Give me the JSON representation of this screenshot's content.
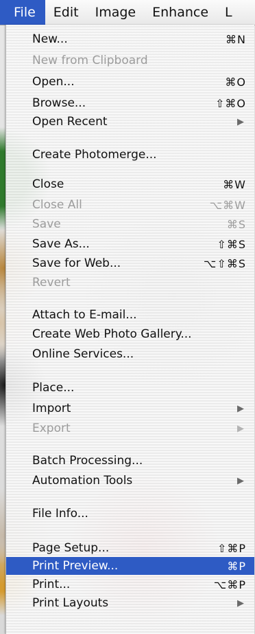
{
  "menubar": {
    "items": [
      "File",
      "Edit",
      "Image",
      "Enhance",
      "L"
    ]
  },
  "menu": {
    "items": [
      {
        "label": "New...",
        "shortcut": "⌘N"
      },
      {
        "label": "New from Clipboard",
        "shortcut": ""
      },
      {
        "label": "Open...",
        "shortcut": "⌘O"
      },
      {
        "label": "Browse...",
        "shortcut": "⇧⌘O"
      },
      {
        "label": "Open Recent",
        "shortcut": "▶"
      },
      {
        "label": "Create Photomerge...",
        "shortcut": ""
      },
      {
        "label": "Close",
        "shortcut": "⌘W"
      },
      {
        "label": "Close All",
        "shortcut": "⌥⌘W"
      },
      {
        "label": "Save",
        "shortcut": "⌘S"
      },
      {
        "label": "Save As...",
        "shortcut": "⇧⌘S"
      },
      {
        "label": "Save for Web...",
        "shortcut": "⌥⇧⌘S"
      },
      {
        "label": "Revert",
        "shortcut": ""
      },
      {
        "label": "Attach to E-mail...",
        "shortcut": ""
      },
      {
        "label": "Create Web Photo Gallery...",
        "shortcut": ""
      },
      {
        "label": "Online Services...",
        "shortcut": ""
      },
      {
        "label": "Place...",
        "shortcut": ""
      },
      {
        "label": "Import",
        "shortcut": "▶"
      },
      {
        "label": "Export",
        "shortcut": "▶"
      },
      {
        "label": "Batch Processing...",
        "shortcut": ""
      },
      {
        "label": "Automation Tools",
        "shortcut": "▶"
      },
      {
        "label": "File Info...",
        "shortcut": ""
      },
      {
        "label": "Page Setup...",
        "shortcut": "⇧⌘P"
      },
      {
        "label": "Print Preview...",
        "shortcut": "⌘P"
      },
      {
        "label": "Print...",
        "shortcut": "⌥⌘P"
      },
      {
        "label": "Print Layouts",
        "shortcut": "▶"
      }
    ]
  },
  "colors": {
    "highlight": "#2e5bc4",
    "disabled_text": "#9c9c9c"
  }
}
